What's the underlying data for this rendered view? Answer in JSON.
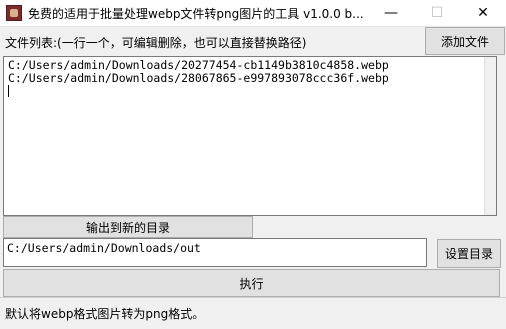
{
  "window": {
    "title": "免费的适用于批量处理webp文件转png图片的工具 v1.0.0    b...",
    "minimize_glyph": "—",
    "maximize_glyph": "☐",
    "close_glyph": "✕"
  },
  "file_list": {
    "label": "文件列表:(一行一个，可编辑删除，也可以直接替换路径)",
    "add_button": "添加文件",
    "lines": [
      "C:/Users/admin/Downloads/20277454-cb1149b3810c4858.webp",
      "C:/Users/admin/Downloads/28067865-e997893078ccc36f.webp"
    ]
  },
  "output": {
    "button": "输出到新的目录",
    "path": "C:/Users/admin/Downloads/out",
    "set_button": "设置目录"
  },
  "execute_button": "执行",
  "status": "默认将webp格式图片转为png格式。"
}
